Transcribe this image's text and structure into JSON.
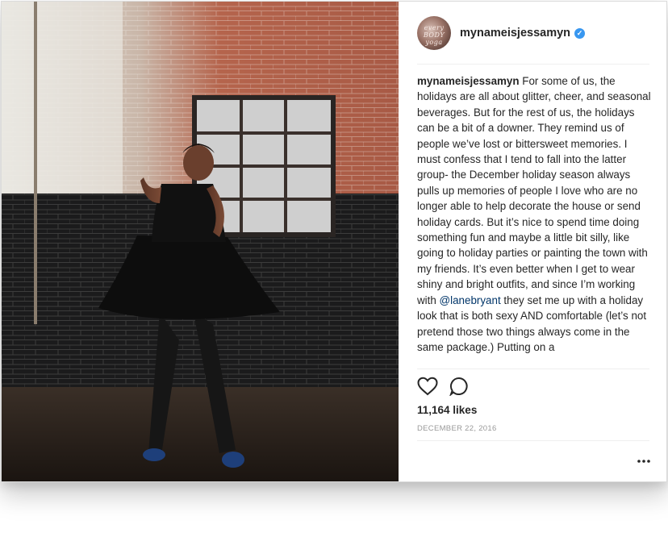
{
  "post": {
    "username": "mynameisjessamyn",
    "avatar_text": "every BODY yoga",
    "verified_icon": "verified-badge-icon",
    "caption_username": "mynameisjessamyn",
    "caption_part1": " For some of us, the holidays are all about glitter, cheer, and seasonal beverages. But for the rest of us, the holidays can be a bit of a downer. They remind us of people we’ve lost or bittersweet memories. I must confess that I tend to fall into the latter group- the December holiday season always pulls up memories of people I love who are no longer able to help decorate the house or send holiday cards. But it’s nice to spend time doing something fun and maybe a little bit silly, like going to holiday parties or painting the town with my friends. It’s even better when I get to wear shiny and bright outfits, and since I’m working with ",
    "mention": "@lanebryant",
    "caption_part2": " they set me up with a holiday look that is both sexy AND comfortable (let’s not pretend those two things always come in the same package.) Putting on a",
    "likes": "11,164 likes",
    "date": "DECEMBER 22, 2016",
    "icons": {
      "like": "heart-icon",
      "comment": "comment-icon",
      "more": "more-options-icon"
    },
    "colors": {
      "username": "#262626",
      "mention": "#003569",
      "verified": "#3897f0",
      "date": "#999999"
    }
  }
}
